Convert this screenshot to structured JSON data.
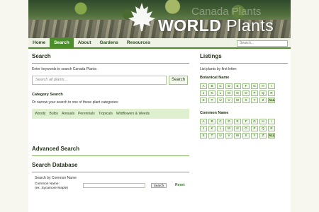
{
  "banner": {
    "title_bold": "WORLD",
    "title_light": "Plants",
    "ghost_text": "Canada Plants"
  },
  "nav": {
    "items": [
      "Home",
      "Search",
      "About",
      "Gardens",
      "Resources"
    ],
    "active": "Search",
    "search_placeholder": "Search..."
  },
  "search": {
    "heading": "Search",
    "instruction": "Enter keywords to search Canada Plants:",
    "placeholder": "Search all plants...",
    "button": "Search"
  },
  "category": {
    "heading": "Category Search",
    "instruction": "Or narrow your search to one of these plant categories:",
    "items": [
      "Woody",
      "Bulbs",
      "Annuals",
      "Perennials",
      "Tropicals",
      "Wildflowers & Weeds"
    ]
  },
  "advanced": {
    "heading": "Advanced Search"
  },
  "database": {
    "heading": "Search Database",
    "subheading": "Search by Common Name",
    "field_label": "Common Name:",
    "field_hint": "(ex. Sycamore Maple)",
    "button": "Search",
    "reset": "Reset"
  },
  "listings": {
    "heading": "Listings",
    "instruction": "List plants by first letter:",
    "botanical_heading": "Botanical Name",
    "common_heading": "Common Name",
    "letters": [
      "A",
      "B",
      "C",
      "D",
      "E",
      "F",
      "G",
      "H",
      "I",
      "J",
      "K",
      "L",
      "M",
      "N",
      "O",
      "P",
      "Q",
      "R",
      "S",
      "T",
      "U",
      "V",
      "W",
      "X",
      "Y",
      "Z",
      "ALL"
    ]
  },
  "colors": {
    "accent": "#4b8d2b",
    "category_bg": "#dff0d0",
    "page_bg": "#f7f7ef"
  }
}
